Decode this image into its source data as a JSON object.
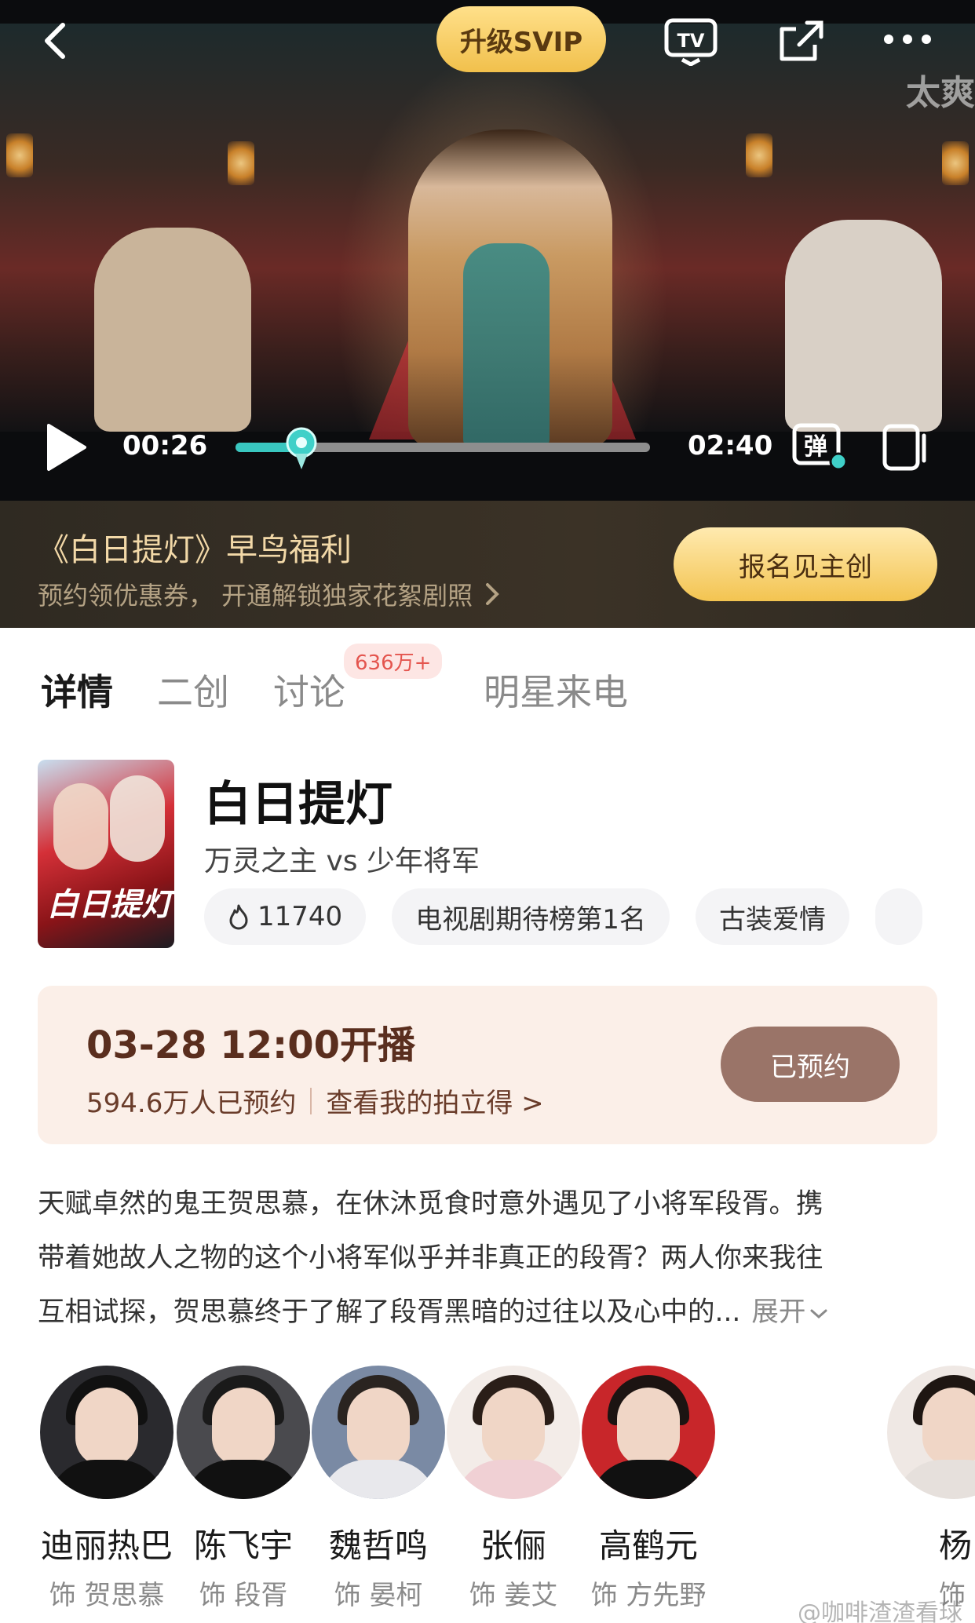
{
  "player": {
    "svip_label": "升级SVIP",
    "corner_text": "太爽",
    "current_time": "00:26",
    "total_time": "02:40",
    "progress": 0.16,
    "danmaku_label": "弹"
  },
  "promo": {
    "title": "《白日提灯》早鸟福利",
    "subtitle": "预约领优惠券， 开通解锁独家花絮剧照",
    "button_label": "报名见主创"
  },
  "tabs": [
    {
      "label": "详情",
      "active": true
    },
    {
      "label": "二创",
      "active": false
    },
    {
      "label": "讨论",
      "active": false,
      "badge": "636万+"
    },
    {
      "label": "明星来电",
      "active": false
    }
  ],
  "show": {
    "poster_text": "白日提灯",
    "title": "白日提灯",
    "subtitle": "万灵之主 vs 少年将军",
    "chips": [
      {
        "icon": "flame-icon",
        "label": "11740"
      },
      {
        "label": "电视剧期待榜第1名"
      },
      {
        "label": "古装爱情"
      }
    ]
  },
  "premiere": {
    "title": "03-28 12:00开播",
    "reservations": "594.6万人已预约",
    "link_label": "查看我的拍立得 >",
    "button_label": "已预约"
  },
  "synopsis": {
    "lines": [
      "天赋卓然的鬼王贺思慕，在休沐觅食时意外遇见了小将军段胥。携",
      "带着她故人之物的这个小将军似乎并非真正的段胥？两人你来我往",
      "互相试探，贺思慕终于了解了段胥黑暗的过往以及心中的..."
    ],
    "expand_label": "展开"
  },
  "cast": [
    {
      "name": "迪丽热巴",
      "role": "饰 贺思慕"
    },
    {
      "name": "陈飞宇",
      "role": "饰 段胥"
    },
    {
      "name": "魏哲鸣",
      "role": "饰 晏柯"
    },
    {
      "name": "张俪",
      "role": "饰 姜艾"
    },
    {
      "name": "高鹤元",
      "role": "饰 方先野"
    },
    {
      "name": "杨",
      "role": "饰"
    }
  ],
  "watermark": "@咖啡渣渣看球"
}
